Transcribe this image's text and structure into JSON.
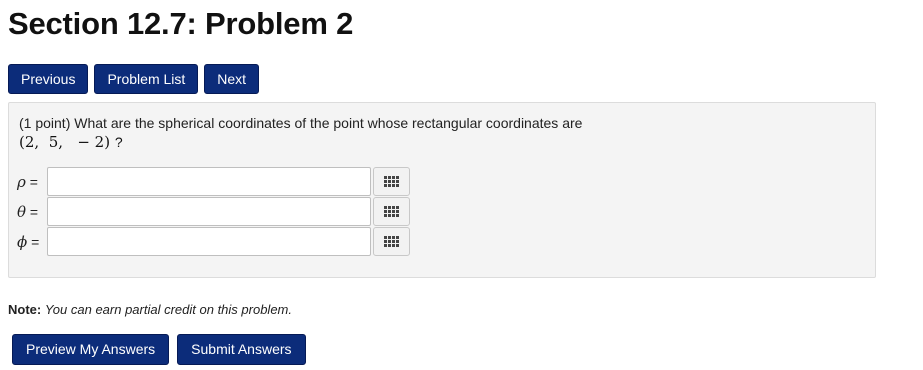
{
  "page_title": "Section 12.7: Problem 2",
  "nav": {
    "previous": "Previous",
    "problem_list": "Problem List",
    "next": "Next"
  },
  "problem": {
    "question": "(1 point) What are the spherical coordinates of the point whose rectangular coordinates are",
    "coordinates": "(2,  5,   − 2)",
    "question_mark": "?"
  },
  "answers": [
    {
      "symbol": "ρ",
      "equals": " =",
      "value": ""
    },
    {
      "symbol": "θ",
      "equals": " =",
      "value": ""
    },
    {
      "symbol": "ϕ",
      "equals": " =",
      "value": ""
    }
  ],
  "note": {
    "label": "Note:",
    "text": "You can earn partial credit on this problem."
  },
  "actions": {
    "preview": "Preview My Answers",
    "submit": "Submit Answers"
  },
  "colors": {
    "button_bg": "#0c2c7a",
    "panel_bg": "#f4f4f4"
  },
  "icons": {
    "equation_editor": "grid-icon"
  }
}
